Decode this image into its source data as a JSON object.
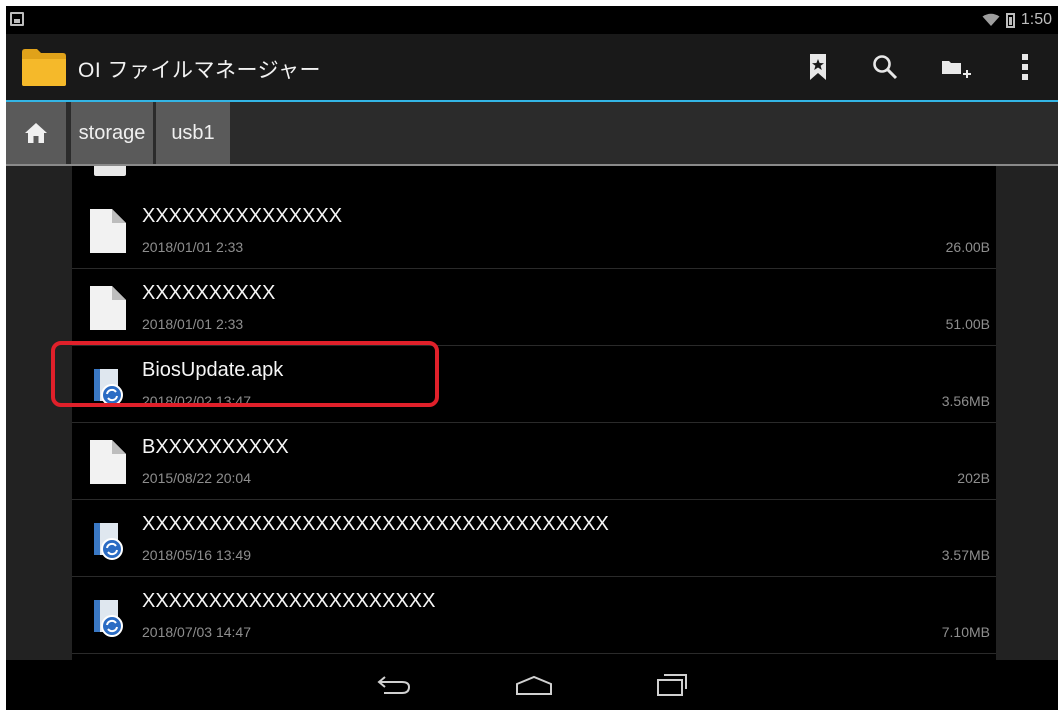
{
  "status_bar": {
    "time": "1:50"
  },
  "action_bar": {
    "title": "OI ファイルマネージャー",
    "icons": [
      "bookmark-icon",
      "search-icon",
      "new-folder-icon",
      "overflow-menu-icon"
    ]
  },
  "breadcrumb": {
    "home_icon": "home-icon",
    "items": [
      {
        "label": "storage"
      },
      {
        "label": "usb1"
      }
    ]
  },
  "files": [
    {
      "name": "XXXXXXXXXXXXXXX",
      "date": "2018/01/01 2:33",
      "size": "26.00B",
      "icon": "file-icon"
    },
    {
      "name": "XXXXXXXXXX",
      "date": "2018/01/01 2:33",
      "size": "51.00B",
      "icon": "file-icon"
    },
    {
      "name": "BiosUpdate.apk",
      "date": "2018/02/02 13:47",
      "size": "3.56MB",
      "icon": "apk-icon"
    },
    {
      "name": "BXXXXXXXXXX",
      "date": "2015/08/22 20:04",
      "size": "202B",
      "icon": "file-icon"
    },
    {
      "name": "XXXXXXXXXXXXXXXXXXXXXXXXXXXXXXXXXXX",
      "date": "2018/05/16 13:49",
      "size": "3.57MB",
      "icon": "apk-icon"
    },
    {
      "name": "XXXXXXXXXXXXXXXXXXXXXX",
      "date": "2018/07/03 14:47",
      "size": "7.10MB",
      "icon": "apk-icon"
    }
  ],
  "highlight_color": "#e0202a",
  "accent_color": "#33b5e5",
  "nav_bar": {
    "icons": [
      "back-icon",
      "home-nav-icon",
      "recent-apps-icon"
    ]
  }
}
